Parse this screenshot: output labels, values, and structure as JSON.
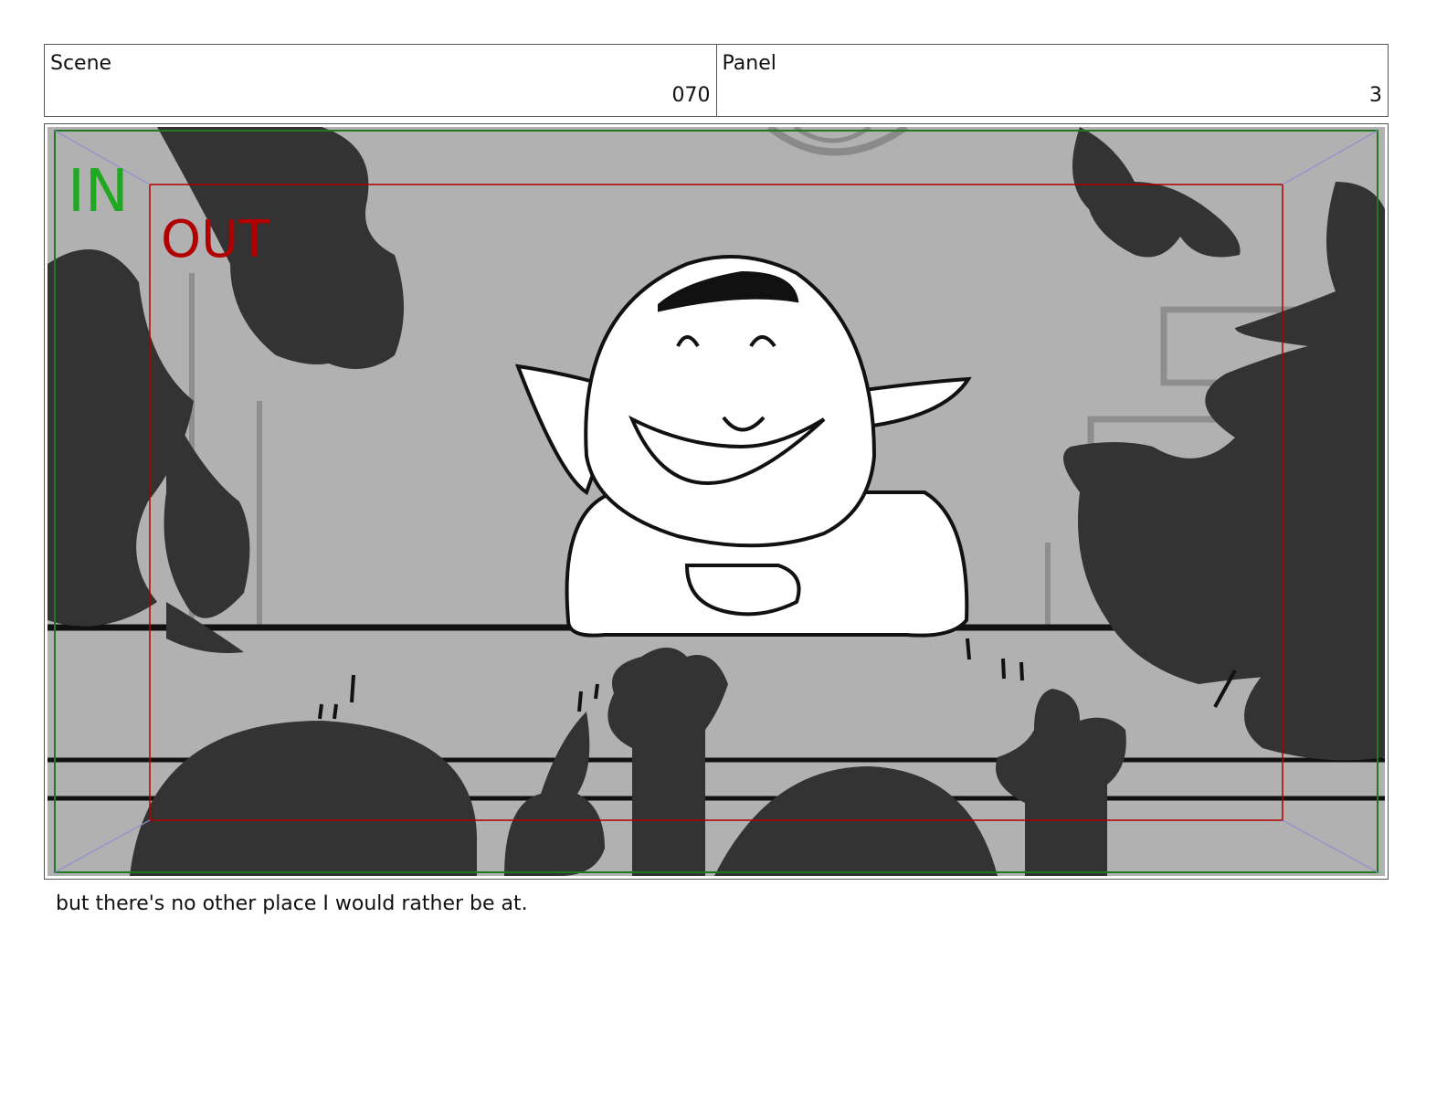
{
  "header": {
    "scene_label": "Scene",
    "scene_value": "070",
    "panel_label": "Panel",
    "panel_value": "3"
  },
  "panel": {
    "in_label": "IN",
    "out_label": "OUT",
    "colors": {
      "in_guide": "#1f7a1f",
      "out_guide": "#b00000",
      "background": "#b1b1b1",
      "silhouette": "#333333"
    }
  },
  "caption": "but there's no other place I would rather be at."
}
